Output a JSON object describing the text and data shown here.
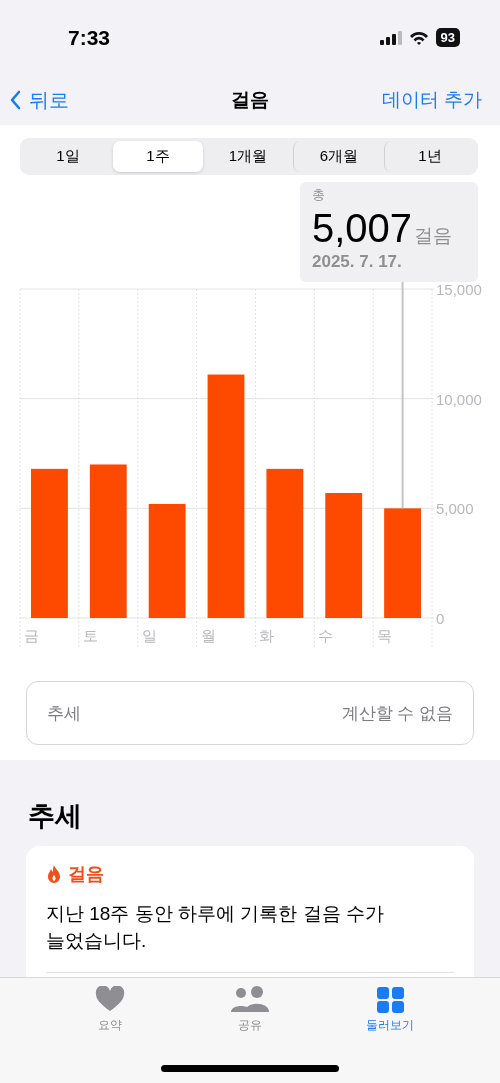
{
  "status_bar": {
    "time": "7:33",
    "battery": "93"
  },
  "nav": {
    "back": "뒤로",
    "title": "걸음",
    "action": "데이터 추가"
  },
  "segments": [
    {
      "label": "1일",
      "selected": false
    },
    {
      "label": "1주",
      "selected": true
    },
    {
      "label": "1개월",
      "selected": false
    },
    {
      "label": "6개월",
      "selected": false
    },
    {
      "label": "1년",
      "selected": false
    }
  ],
  "chart_data": {
    "type": "bar",
    "categories": [
      "금",
      "토",
      "일",
      "월",
      "화",
      "수",
      "목"
    ],
    "values": [
      6800,
      7000,
      5200,
      11100,
      6800,
      5700,
      5000
    ],
    "ylim": [
      0,
      15000
    ],
    "yticks": [
      {
        "value": 0,
        "label": "0"
      },
      {
        "value": 5000,
        "label": "5,000"
      },
      {
        "value": 10000,
        "label": "10,000"
      },
      {
        "value": 15000,
        "label": "15,000"
      }
    ]
  },
  "selection": {
    "label": "총",
    "value": "5,007",
    "unit": "걸음",
    "date": "2025. 7. 17."
  },
  "trend_row": {
    "label": "추세",
    "value": "계산할 수 없음"
  },
  "trends_section": {
    "heading": "추세",
    "card": {
      "title": "걸음",
      "text": "지난 18주 동안 하루에 기록한 걸음 수가 늘었습니다."
    }
  },
  "tab_bar": [
    {
      "label": "요약",
      "kind": "heart",
      "selected": false
    },
    {
      "label": "공유",
      "kind": "people",
      "selected": false
    },
    {
      "label": "둘러보기",
      "kind": "grid",
      "selected": true
    }
  ]
}
